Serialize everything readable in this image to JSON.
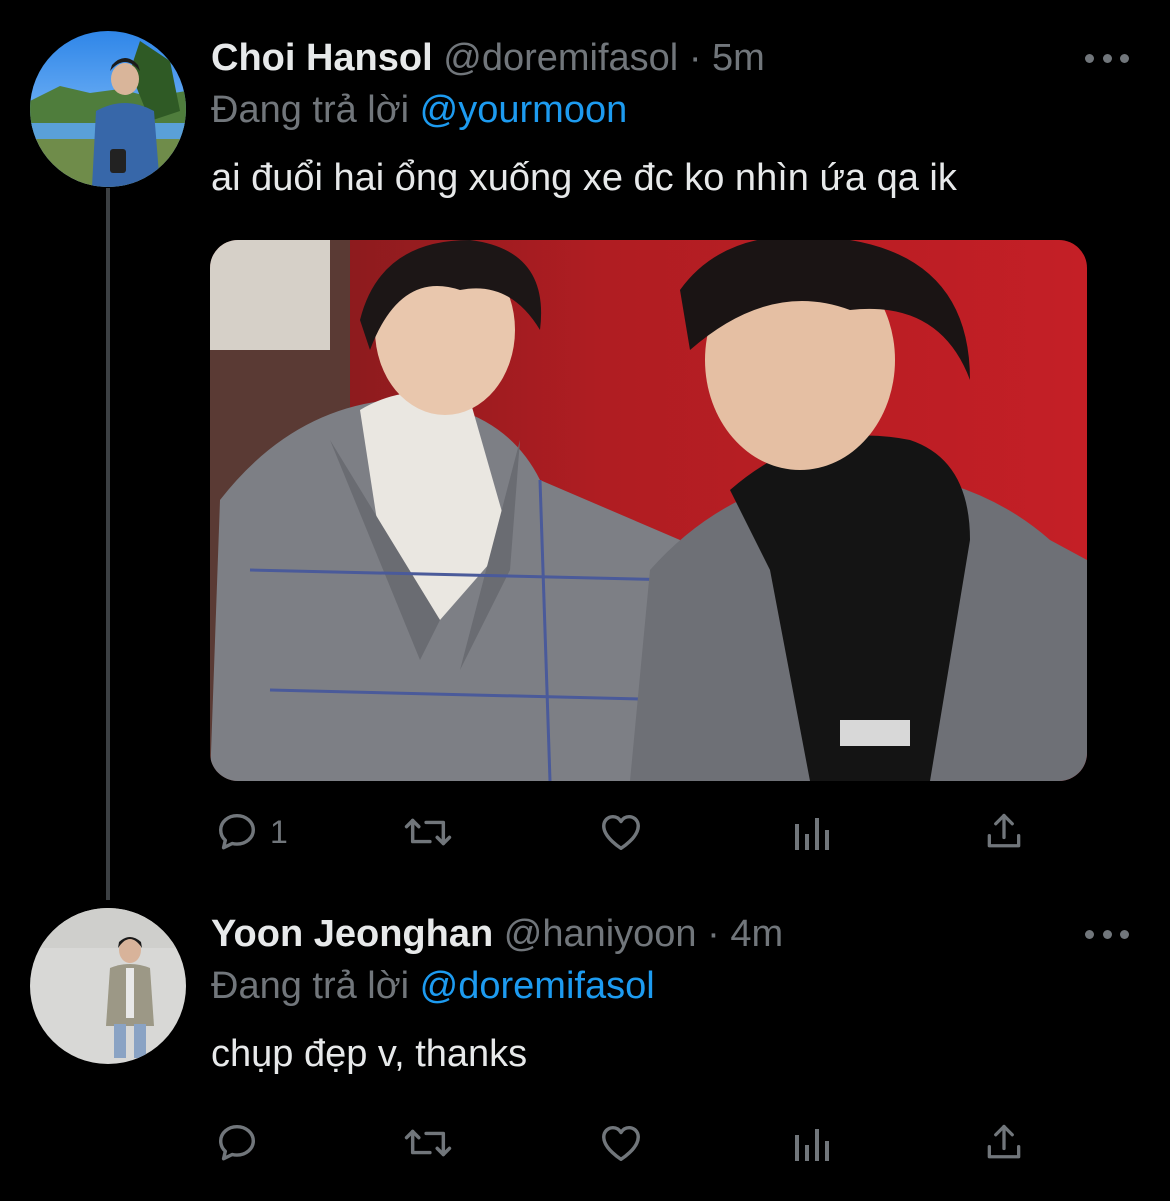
{
  "colors": {
    "background": "#000000",
    "text_primary": "#e7e9ea",
    "text_secondary": "#71767b",
    "accent": "#1d9bf0",
    "thread_line": "#3c4043"
  },
  "tweets": [
    {
      "display_name": "Choi Hansol",
      "handle": "@doremifasol",
      "separator": "·",
      "time": "5m",
      "reply_prefix": "Đang trả lời",
      "reply_to": "@yourmoon",
      "text": "ai đuổi hai ổng xuống xe đc ko nhìn ứa qa ik",
      "actions": {
        "reply_count": "1",
        "retweet_count": "",
        "like_count": ""
      },
      "icons": [
        "more-icon",
        "reply-icon",
        "retweet-icon",
        "like-icon",
        "stats-icon",
        "share-icon"
      ]
    },
    {
      "display_name": "Yoon Jeonghan",
      "handle": "@haniyoon",
      "separator": "·",
      "time": "4m",
      "reply_prefix": "Đang trả lời",
      "reply_to": "@doremifasol",
      "text": "chụp đẹp v, thanks",
      "actions": {
        "reply_count": "",
        "retweet_count": "",
        "like_count": ""
      },
      "icons": [
        "more-icon",
        "reply-icon",
        "retweet-icon",
        "like-icon",
        "stats-icon",
        "share-icon"
      ]
    }
  ]
}
